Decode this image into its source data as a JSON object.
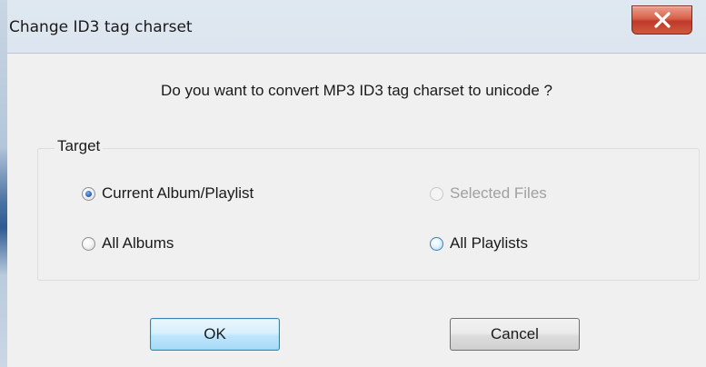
{
  "window": {
    "title": "Change ID3 tag charset",
    "close_icon": "close-x-icon"
  },
  "dialog": {
    "question": "Do you want to convert MP3 ID3 tag charset to unicode ?",
    "group": {
      "label": "Target",
      "options": [
        {
          "label": "Current Album/Playlist",
          "checked": true,
          "enabled": true
        },
        {
          "label": "Selected Files",
          "checked": false,
          "enabled": false
        },
        {
          "label": "All Albums",
          "checked": false,
          "enabled": true
        },
        {
          "label": "All Playlists",
          "checked": false,
          "enabled": true,
          "hover": true
        }
      ]
    },
    "buttons": {
      "ok": "OK",
      "cancel": "Cancel"
    }
  },
  "colors": {
    "accent": "#3c7fb1",
    "close": "#c0392b",
    "face": "#f0f0f0"
  }
}
